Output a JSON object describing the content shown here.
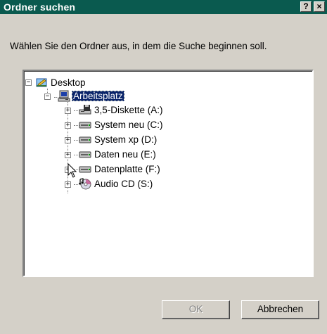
{
  "window": {
    "title": "Ordner suchen",
    "help_label": "?",
    "close_label": "×"
  },
  "instruction": "Wählen Sie den Ordner aus, in dem die Suche beginnen soll.",
  "tree": {
    "root": {
      "label": "Desktop",
      "icon": "desktop-icon",
      "expander": "−"
    },
    "computer": {
      "label": "Arbeitsplatz",
      "icon": "computer-icon",
      "expander": "−",
      "selected": true
    },
    "drives": [
      {
        "label": "3,5-Diskette (A:)",
        "icon": "floppy-drive-icon",
        "expander": "+"
      },
      {
        "label": "System neu (C:)",
        "icon": "hard-drive-icon",
        "expander": "+"
      },
      {
        "label": "System xp (D:)",
        "icon": "hard-drive-icon",
        "expander": "+"
      },
      {
        "label": "Daten neu (E:)",
        "icon": "hard-drive-icon",
        "expander": "+"
      },
      {
        "label": "Datenplatte (F:)",
        "icon": "hard-drive-icon",
        "expander": "+"
      },
      {
        "label": "Audio CD (S:)",
        "icon": "cd-drive-icon",
        "expander": "+"
      }
    ]
  },
  "buttons": {
    "ok_label": "OK",
    "ok_enabled": false,
    "cancel_label": "Abbrechen"
  },
  "colors": {
    "titlebar": "#0a5a4f",
    "selection": "#0a246a",
    "face": "#d4d0c8"
  }
}
